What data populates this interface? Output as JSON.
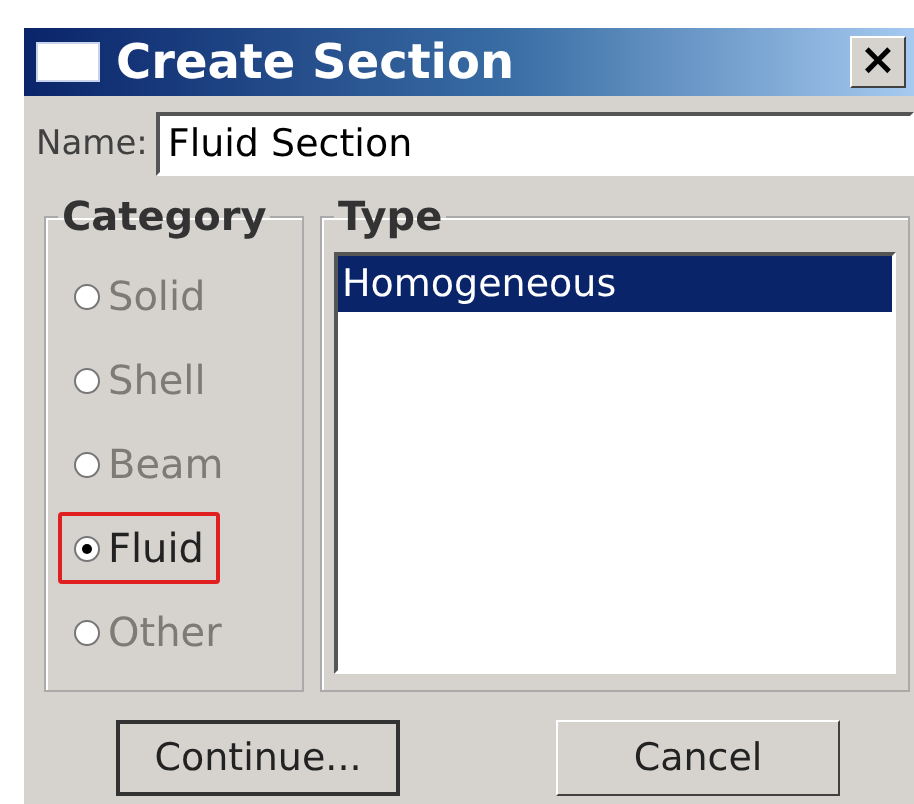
{
  "window": {
    "title": "Create Section",
    "close": "×"
  },
  "name_field": {
    "label": "Name:",
    "value": "Fluid Section"
  },
  "category": {
    "title": "Category",
    "options": [
      {
        "label": "Solid",
        "selected": false,
        "disabled": true,
        "highlighted": false
      },
      {
        "label": "Shell",
        "selected": false,
        "disabled": true,
        "highlighted": false
      },
      {
        "label": "Beam",
        "selected": false,
        "disabled": true,
        "highlighted": false
      },
      {
        "label": "Fluid",
        "selected": true,
        "disabled": false,
        "highlighted": true
      },
      {
        "label": "Other",
        "selected": false,
        "disabled": true,
        "highlighted": false
      }
    ]
  },
  "type": {
    "title": "Type",
    "items": [
      {
        "label": "Homogeneous",
        "selected": true
      }
    ]
  },
  "buttons": [
    "Continue...",
    "Cancel"
  ]
}
